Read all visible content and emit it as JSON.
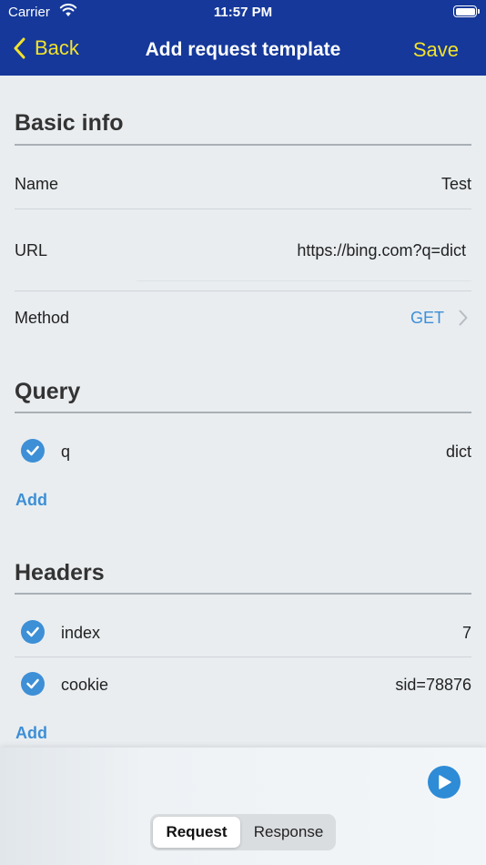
{
  "status_bar": {
    "carrier": "Carrier",
    "time": "11:57 PM"
  },
  "nav": {
    "back_label": "Back",
    "title": "Add request template",
    "save_label": "Save"
  },
  "basic_info": {
    "title": "Basic info",
    "name_label": "Name",
    "name_value": "Test",
    "url_label": "URL",
    "url_value": "https://bing.com?q=dict",
    "method_label": "Method",
    "method_value": "GET"
  },
  "query": {
    "title": "Query",
    "params": [
      {
        "key": "q",
        "value": "dict",
        "enabled": true
      }
    ],
    "add_label": "Add"
  },
  "headers": {
    "title": "Headers",
    "items": [
      {
        "key": "index",
        "value": "7",
        "enabled": true
      },
      {
        "key": "cookie",
        "value": "sid=78876",
        "enabled": true
      }
    ],
    "add_label": "Add"
  },
  "bottom": {
    "tabs": [
      {
        "label": "Request",
        "selected": true
      },
      {
        "label": "Response",
        "selected": false
      }
    ]
  },
  "colors": {
    "nav_background": "#15389a",
    "nav_accent": "#f3e22b",
    "link_blue": "#3d8fd6",
    "page_background": "#e9edf0"
  },
  "icons": [
    "wifi-icon",
    "battery-icon",
    "chevron-left-icon",
    "chevron-right-icon",
    "checkmark-circle-icon",
    "play-icon"
  ]
}
